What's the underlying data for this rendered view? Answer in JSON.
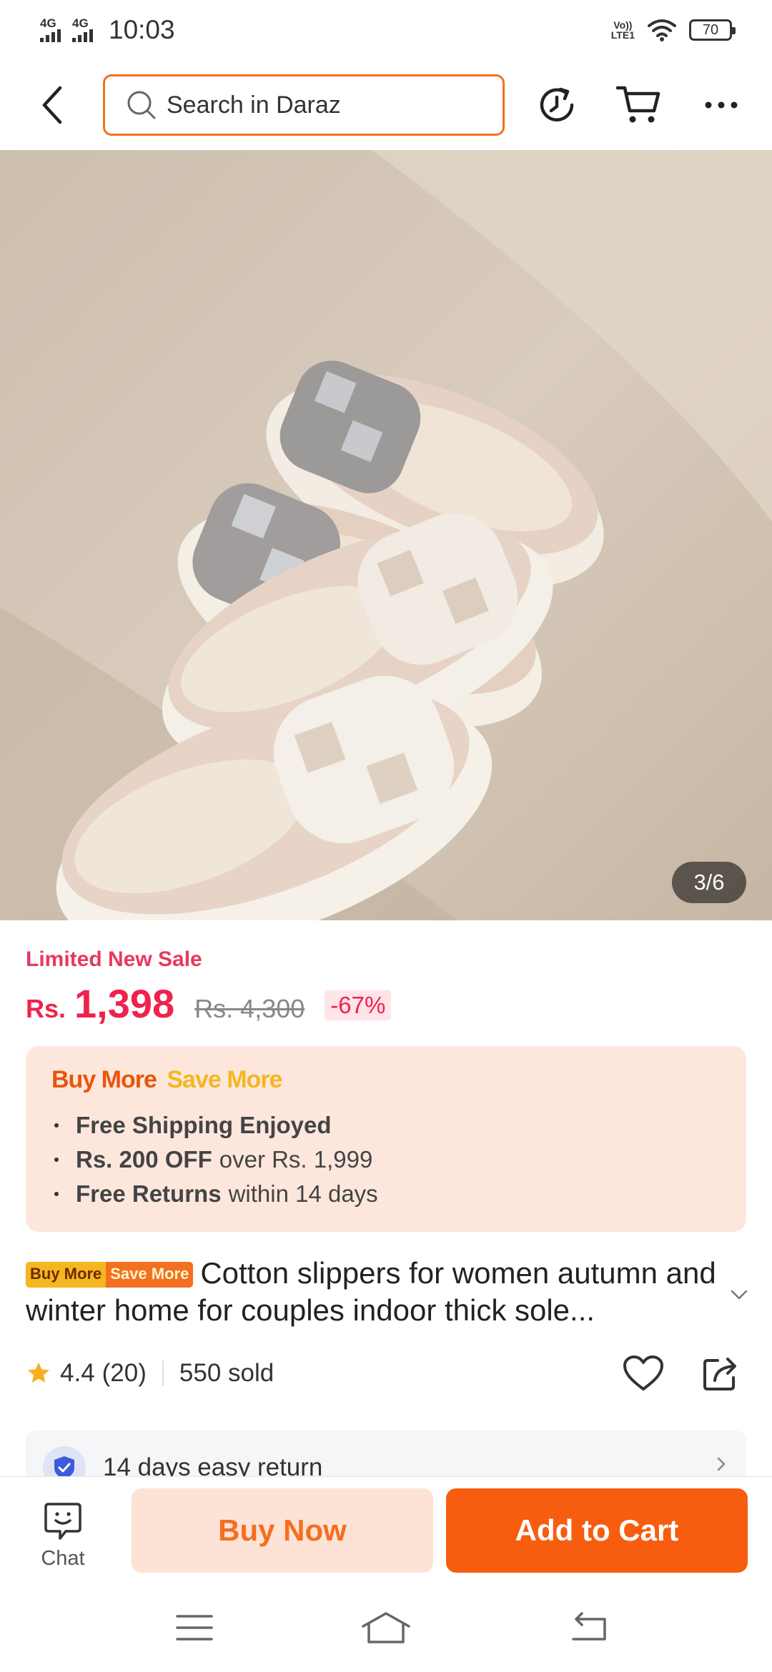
{
  "status_bar": {
    "network_1": "4G",
    "network_2": "4G",
    "time": "10:03",
    "volte_line1": "Vo))",
    "volte_line2": "LTE1",
    "battery": "70"
  },
  "header": {
    "back_icon": "chevron-left-icon",
    "search": {
      "placeholder": "Search in Daraz",
      "icon": "search-icon"
    },
    "history_icon": "history-icon",
    "cart_icon": "cart-icon",
    "more_icon": "more-dots-icon"
  },
  "gallery": {
    "counter": "3/6",
    "description": "product photo"
  },
  "pricing": {
    "sale_label": "Limited New Sale",
    "currency": "Rs.",
    "price": "1,398",
    "original_price": "Rs. 4,300",
    "discount": "-67%"
  },
  "promo": {
    "title_part1": "Buy More",
    "title_part2": "Save More",
    "items": [
      {
        "bold": "Free Shipping Enjoyed",
        "rest": ""
      },
      {
        "bold": "Rs. 200 OFF",
        "rest": "over Rs. 1,999"
      },
      {
        "bold": "Free Returns",
        "rest": "within 14 days"
      }
    ]
  },
  "product": {
    "badge_part1": "Buy More",
    "badge_part2": "Save More",
    "title": "Cotton slippers for women autumn and winter home for couples indoor thick sole...",
    "rating": "4.4",
    "reviews": "(20)",
    "sold": "550 sold"
  },
  "return_policy": {
    "label": "14 days easy return"
  },
  "actions": {
    "chat_label": "Chat",
    "buy_now": "Buy Now",
    "add_to_cart": "Add to Cart"
  },
  "colors": {
    "brand_orange": "#f36f21",
    "price_red": "#f0224c",
    "add_cart_bg": "#f75d0f",
    "buy_now_bg": "#fde2d6",
    "promo_bg": "#fde7dd"
  }
}
